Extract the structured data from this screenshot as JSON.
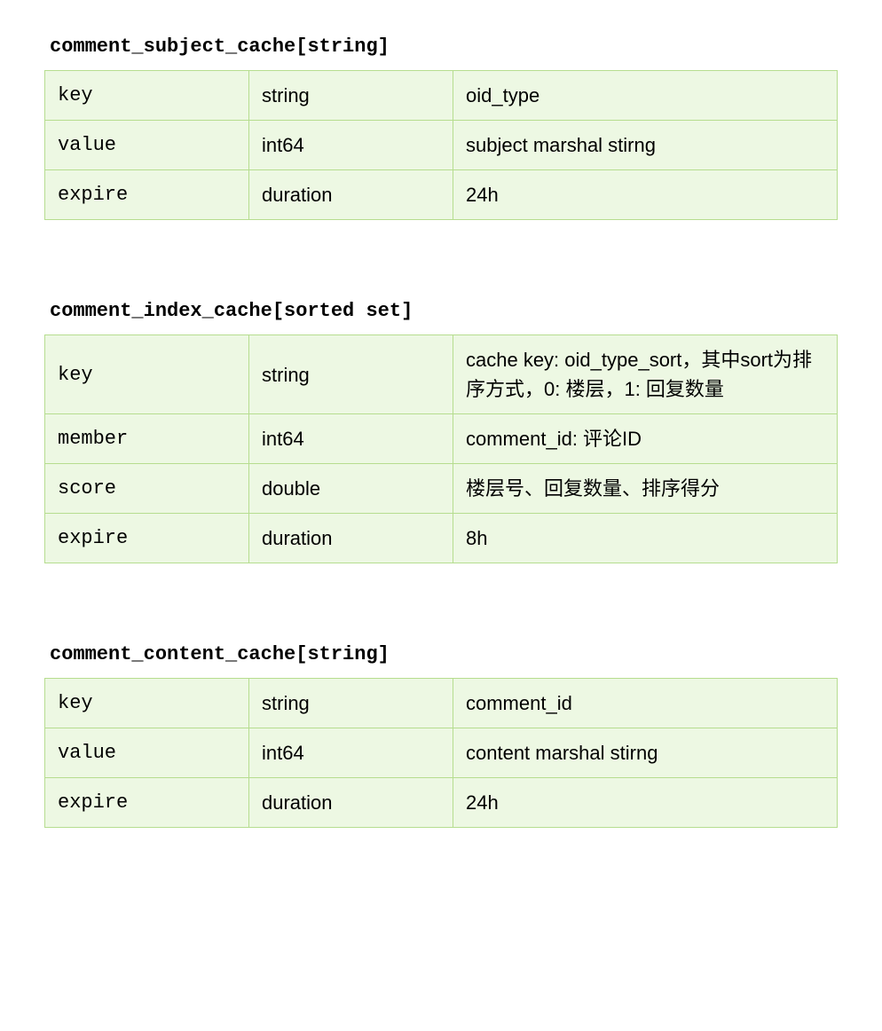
{
  "sections": [
    {
      "title": "comment_subject_cache[string]",
      "rows": [
        {
          "c1": "key",
          "c2": "string",
          "c3": "oid_type"
        },
        {
          "c1": "value",
          "c2": "int64",
          "c3": "subject marshal stirng"
        },
        {
          "c1": "expire",
          "c2": "duration",
          "c3": "24h"
        }
      ]
    },
    {
      "title": "comment_index_cache[sorted set]",
      "rows": [
        {
          "c1": "key",
          "c2": "string",
          "c3": "cache key: oid_type_sort，其中sort为排序方式，0: 楼层，1: 回复数量"
        },
        {
          "c1": "member",
          "c2": "int64",
          "c3": "comment_id: 评论ID"
        },
        {
          "c1": "score",
          "c2": "double",
          "c3": "楼层号、回复数量、排序得分"
        },
        {
          "c1": "expire",
          "c2": "duration",
          "c3": "8h"
        }
      ]
    },
    {
      "title": "comment_content_cache[string]",
      "rows": [
        {
          "c1": "key",
          "c2": "string",
          "c3": "comment_id"
        },
        {
          "c1": "value",
          "c2": "int64",
          "c3": "content marshal stirng"
        },
        {
          "c1": "expire",
          "c2": "duration",
          "c3": "24h"
        }
      ]
    }
  ]
}
